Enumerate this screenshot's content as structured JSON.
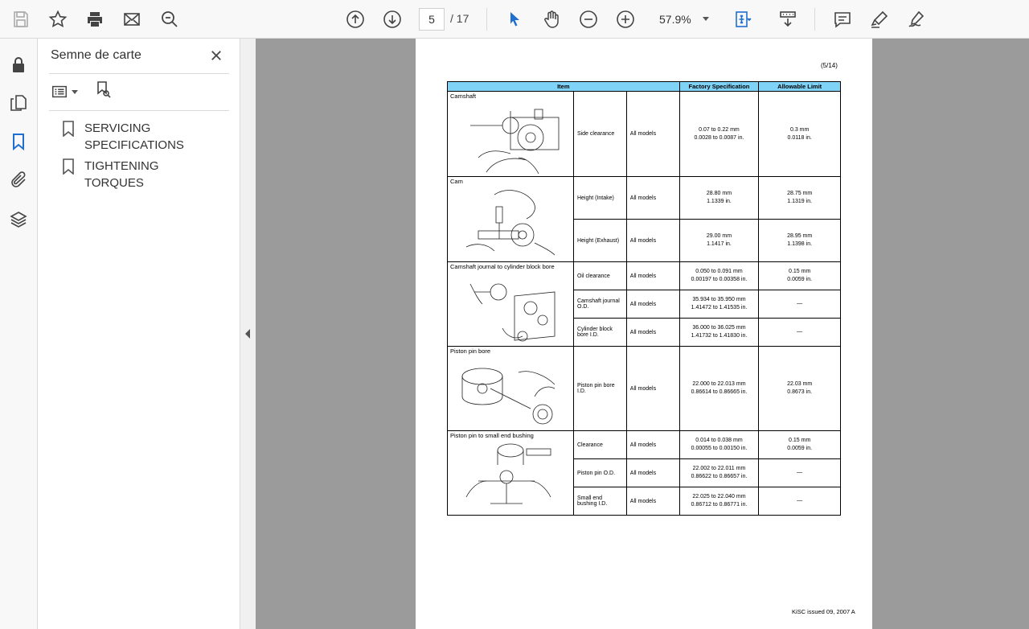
{
  "toolbar": {
    "page_current": "5",
    "page_total": "/  17",
    "zoom": "57.9%"
  },
  "panel": {
    "title": "Semne de carte",
    "bookmarks": [
      {
        "label": "SERVICING SPECIFICATIONS"
      },
      {
        "label": "TIGHTENING TORQUES"
      }
    ]
  },
  "document": {
    "page_label": "(5/14)",
    "footer": "KiSC issued 09, 2007 A",
    "headers": {
      "item": "Item",
      "factory": "Factory Specification",
      "allowable": "Allowable Limit"
    },
    "groups": [
      {
        "title": "Camshaft",
        "rows": [
          {
            "param": "Side clearance",
            "models": "All models",
            "factory": [
              "0.07 to 0.22 mm",
              "0.0028 to 0.0087 in."
            ],
            "limit": [
              "0.3 mm",
              "0.0118 in."
            ]
          }
        ]
      },
      {
        "title": "Cam",
        "rows": [
          {
            "param": "Height (Intake)",
            "models": "All models",
            "factory": [
              "28.80 mm",
              "1.1339 in."
            ],
            "limit": [
              "28.75 mm",
              "1.1319 in."
            ]
          },
          {
            "param": "Height (Exhaust)",
            "models": "All models",
            "factory": [
              "29.00 mm",
              "1.1417 in."
            ],
            "limit": [
              "28.95 mm",
              "1.1398 in."
            ]
          }
        ]
      },
      {
        "title": "Camshaft journal to cylinder block bore",
        "rows": [
          {
            "param": "Oil clearance",
            "models": "All models",
            "factory": [
              "0.050 to 0.091 mm",
              "0.00197 to 0.00358 in."
            ],
            "limit": [
              "0.15 mm",
              "0.0059 in."
            ]
          },
          {
            "param": "Camshaft journal O.D.",
            "models": "All models",
            "factory": [
              "35.934 to 35.950 mm",
              "1.41472 to 1.41535 in."
            ],
            "limit": [
              "—",
              ""
            ]
          },
          {
            "param": "Cylinder block bore I.D.",
            "models": "All models",
            "factory": [
              "36.000 to 36.025 mm",
              "1.41732 to 1.41830 in."
            ],
            "limit": [
              "—",
              ""
            ]
          }
        ]
      },
      {
        "title": "Piston pin bore",
        "rows": [
          {
            "param": "Piston pin bore I.D.",
            "models": "All models",
            "factory": [
              "22.000 to 22.013 mm",
              "0.86614 to 0.86665 in."
            ],
            "limit": [
              "22.03 mm",
              "0.8673 in."
            ]
          }
        ]
      },
      {
        "title": "Piston pin to small end bushing",
        "rows": [
          {
            "param": "Clearance",
            "models": "All models",
            "factory": [
              "0.014 to 0.038 mm",
              "0.00055 to 0.00150 in."
            ],
            "limit": [
              "0.15 mm",
              "0.0059 in."
            ]
          },
          {
            "param": "Piston pin O.D.",
            "models": "All models",
            "factory": [
              "22.002 to 22.011 mm",
              "0.86622 to 0.86657 in."
            ],
            "limit": [
              "—",
              ""
            ]
          },
          {
            "param": "Small end bushing I.D.",
            "models": "All models",
            "factory": [
              "22.025 to 22.040 mm",
              "0.86712 to 0.86771 in."
            ],
            "limit": [
              "—",
              ""
            ]
          }
        ]
      }
    ]
  }
}
